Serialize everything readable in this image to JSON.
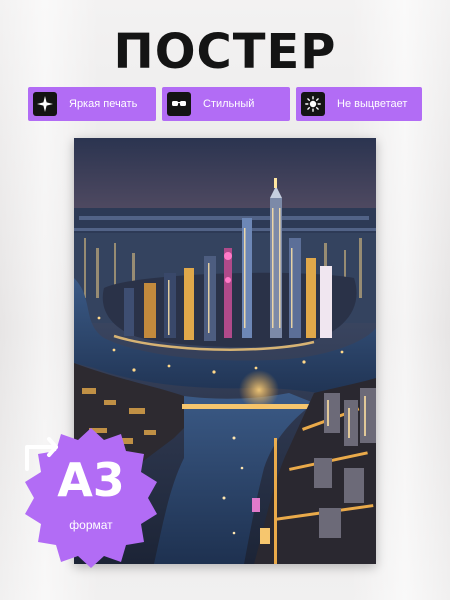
{
  "title": "ПОСТЕР",
  "badges": [
    {
      "label": "Яркая печать",
      "icon": "sparkle-icon"
    },
    {
      "label": "Стильный",
      "icon": "sunglasses-icon"
    },
    {
      "label": "Не выцветает",
      "icon": "sun-icon"
    }
  ],
  "poster": {
    "image": "night-city-skyline-river"
  },
  "format": {
    "value": "А3",
    "label": "формат",
    "icon": "expand-arrow-icon"
  },
  "colors": {
    "accent": "#b26cf5",
    "dark": "#141414"
  }
}
